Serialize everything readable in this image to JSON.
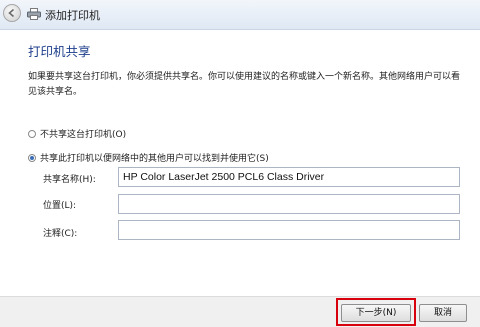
{
  "window": {
    "title": "添加打印机"
  },
  "page": {
    "heading": "打印机共享",
    "description": "如果要共享这台打印机，你必须提供共享名。你可以使用建议的名称或键入一个新名称。其他网络用户可以看见该共享名。"
  },
  "sharing": {
    "options": [
      {
        "label": "不共享这台打印机(O)",
        "selected": false
      },
      {
        "label": "共享此打印机以便网络中的其他用户可以找到并使用它(S)",
        "selected": true
      }
    ]
  },
  "fields": {
    "share_name": {
      "label": "共享名称(H):",
      "value": "HP Color LaserJet 2500 PCL6 Class Driver"
    },
    "location": {
      "label": "位置(L):",
      "value": ""
    },
    "comment": {
      "label": "注释(C):",
      "value": ""
    }
  },
  "footer": {
    "next_label": "下一步(N)",
    "cancel_label": "取消",
    "highlight_color": "#d9000d"
  },
  "icons": {
    "back": "back-arrow-icon",
    "printer": "printer-icon"
  }
}
